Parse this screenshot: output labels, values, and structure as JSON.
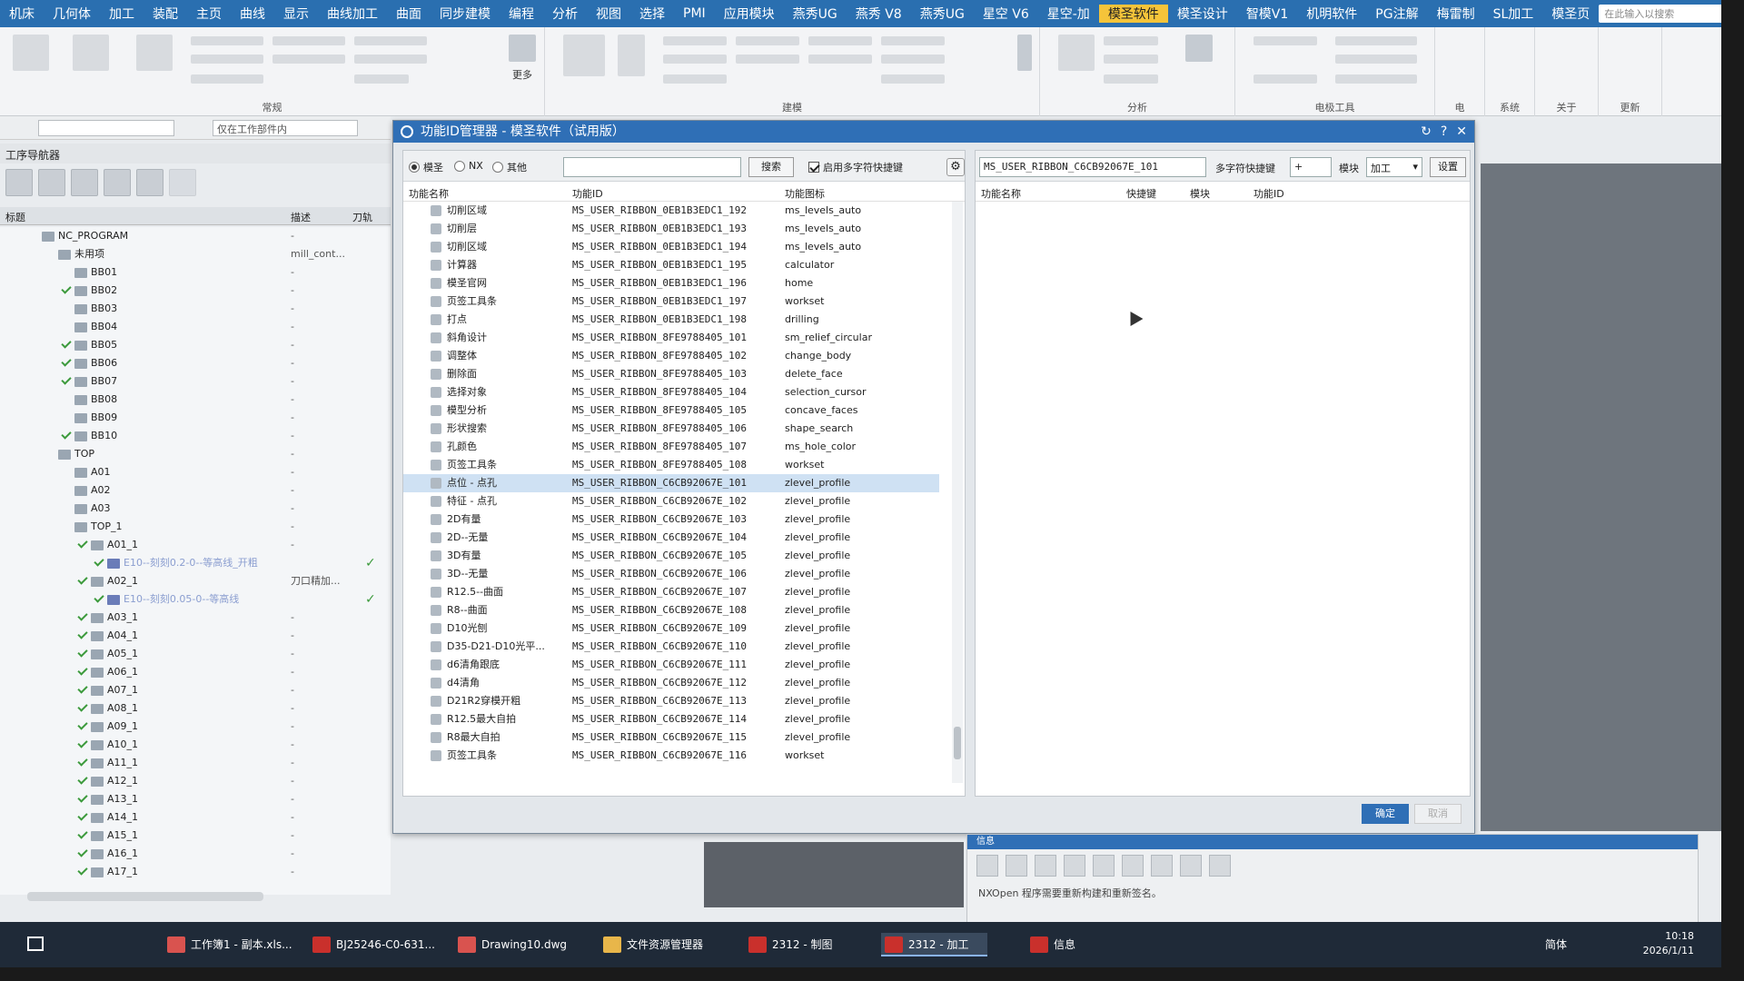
{
  "menubar": {
    "items": [
      "机床",
      "几何体",
      "加工",
      "装配",
      "主页",
      "曲线",
      "显示",
      "曲线加工",
      "曲面",
      "同步建模",
      "编程",
      "分析",
      "视图",
      "选择",
      "PMI",
      "应用模块",
      "燕秀UG",
      "燕秀 V8",
      "燕秀UG",
      "星空 V6",
      "星空-加",
      "模圣软件",
      "模圣设计",
      "智模V1",
      "机明软件",
      "PG注解",
      "梅雷制",
      "SL加工",
      "模圣页"
    ],
    "active_index": 21,
    "search_placeholder": "在此输入以搜索"
  },
  "ribbon": {
    "groups": [
      "常规",
      "建模",
      "分析",
      "电极工具",
      "电",
      "系统",
      "关于",
      "更新"
    ],
    "more_label": "更多"
  },
  "filter": {
    "combo2": "仅在工作部件内"
  },
  "navigator": {
    "title": "工序导航器",
    "col_name": "标题",
    "col_desc": "描述",
    "col_tool": "刀轨",
    "rows": [
      {
        "label": "NC_PROGRAM",
        "indent": 0,
        "check": false,
        "desc": "-"
      },
      {
        "label": "未用项",
        "indent": 1,
        "check": false,
        "desc": "mill_cont..."
      },
      {
        "label": "BB01",
        "indent": 2,
        "check": false,
        "desc": "-"
      },
      {
        "label": "BB02",
        "indent": 2,
        "check": true,
        "desc": "-"
      },
      {
        "label": "BB03",
        "indent": 2,
        "check": false,
        "desc": "-"
      },
      {
        "label": "BB04",
        "indent": 2,
        "check": false,
        "desc": "-"
      },
      {
        "label": "BB05",
        "indent": 2,
        "check": true,
        "desc": "-"
      },
      {
        "label": "BB06",
        "indent": 2,
        "check": true,
        "desc": "-"
      },
      {
        "label": "BB07",
        "indent": 2,
        "check": true,
        "desc": "-"
      },
      {
        "label": "BB08",
        "indent": 2,
        "check": false,
        "desc": "-"
      },
      {
        "label": "BB09",
        "indent": 2,
        "check": false,
        "desc": "-"
      },
      {
        "label": "BB10",
        "indent": 2,
        "check": true,
        "desc": "-"
      },
      {
        "label": "TOP",
        "indent": 1,
        "check": false,
        "desc": "-"
      },
      {
        "label": "A01",
        "indent": 2,
        "check": false,
        "desc": "-"
      },
      {
        "label": "A02",
        "indent": 2,
        "check": false,
        "desc": "-"
      },
      {
        "label": "A03",
        "indent": 2,
        "check": false,
        "desc": "-"
      },
      {
        "label": "TOP_1",
        "indent": 2,
        "check": false,
        "desc": "-"
      },
      {
        "label": "A01_1",
        "indent": 3,
        "check": true,
        "desc": "-"
      },
      {
        "label": "E10--刻刻0.2-0--等高线_开粗",
        "indent": 4,
        "check": true,
        "desc": "",
        "op": true,
        "done": true
      },
      {
        "label": "A02_1",
        "indent": 3,
        "check": true,
        "desc": "刀口精加..."
      },
      {
        "label": "E10--刻刻0.05-0--等高线",
        "indent": 4,
        "check": true,
        "desc": "",
        "op": true,
        "done": true
      },
      {
        "label": "A03_1",
        "indent": 3,
        "check": true,
        "desc": "-"
      },
      {
        "label": "A04_1",
        "indent": 3,
        "check": true,
        "desc": "-"
      },
      {
        "label": "A05_1",
        "indent": 3,
        "check": true,
        "desc": "-"
      },
      {
        "label": "A06_1",
        "indent": 3,
        "check": true,
        "desc": "-"
      },
      {
        "label": "A07_1",
        "indent": 3,
        "check": true,
        "desc": "-"
      },
      {
        "label": "A08_1",
        "indent": 3,
        "check": true,
        "desc": "-"
      },
      {
        "label": "A09_1",
        "indent": 3,
        "check": true,
        "desc": "-"
      },
      {
        "label": "A10_1",
        "indent": 3,
        "check": true,
        "desc": "-"
      },
      {
        "label": "A11_1",
        "indent": 3,
        "check": true,
        "desc": "-"
      },
      {
        "label": "A12_1",
        "indent": 3,
        "check": true,
        "desc": "-"
      },
      {
        "label": "A13_1",
        "indent": 3,
        "check": true,
        "desc": "-"
      },
      {
        "label": "A14_1",
        "indent": 3,
        "check": true,
        "desc": "-"
      },
      {
        "label": "A15_1",
        "indent": 3,
        "check": true,
        "desc": "-"
      },
      {
        "label": "A16_1",
        "indent": 3,
        "check": true,
        "desc": "-"
      },
      {
        "label": "A17_1",
        "indent": 3,
        "check": true,
        "desc": "-"
      }
    ]
  },
  "dialog": {
    "title": "功能ID管理器 - 模圣软件（试用版）",
    "radio_mosheng": "模圣",
    "radio_nx": "NX",
    "radio_other": "其他",
    "search_button": "搜索",
    "multi_char_check": "启用多字符快捷键",
    "col_name": "功能名称",
    "col_id": "功能ID",
    "col_icon": "功能图标",
    "rows": [
      {
        "name": "切削区域",
        "id": "MS_USER_RIBBON_0EB1B3EDC1_192",
        "icon": "ms_levels_auto"
      },
      {
        "name": "切削层",
        "id": "MS_USER_RIBBON_0EB1B3EDC1_193",
        "icon": "ms_levels_auto"
      },
      {
        "name": "切削区域",
        "id": "MS_USER_RIBBON_0EB1B3EDC1_194",
        "icon": "ms_levels_auto"
      },
      {
        "name": "计算器",
        "id": "MS_USER_RIBBON_0EB1B3EDC1_195",
        "icon": "calculator"
      },
      {
        "name": "模圣官网",
        "id": "MS_USER_RIBBON_0EB1B3EDC1_196",
        "icon": "home"
      },
      {
        "name": "页签工具条",
        "id": "MS_USER_RIBBON_0EB1B3EDC1_197",
        "icon": "workset"
      },
      {
        "name": "打点",
        "id": "MS_USER_RIBBON_0EB1B3EDC1_198",
        "icon": "drilling"
      },
      {
        "name": "斜角设计",
        "id": "MS_USER_RIBBON_8FE9788405_101",
        "icon": "sm_relief_circular"
      },
      {
        "name": "调整体",
        "id": "MS_USER_RIBBON_8FE9788405_102",
        "icon": "change_body"
      },
      {
        "name": "删除面",
        "id": "MS_USER_RIBBON_8FE9788405_103",
        "icon": "delete_face"
      },
      {
        "name": "选择对象",
        "id": "MS_USER_RIBBON_8FE9788405_104",
        "icon": "selection_cursor"
      },
      {
        "name": "模型分析",
        "id": "MS_USER_RIBBON_8FE9788405_105",
        "icon": "concave_faces"
      },
      {
        "name": "形状搜索",
        "id": "MS_USER_RIBBON_8FE9788405_106",
        "icon": "shape_search"
      },
      {
        "name": "孔颜色",
        "id": "MS_USER_RIBBON_8FE9788405_107",
        "icon": "ms_hole_color"
      },
      {
        "name": "页签工具条",
        "id": "MS_USER_RIBBON_8FE9788405_108",
        "icon": "workset"
      },
      {
        "name": "点位 - 点孔",
        "id": "MS_USER_RIBBON_C6CB92067E_101",
        "icon": "zlevel_profile",
        "selected": true
      },
      {
        "name": "特征 - 点孔",
        "id": "MS_USER_RIBBON_C6CB92067E_102",
        "icon": "zlevel_profile"
      },
      {
        "name": "2D有量",
        "id": "MS_USER_RIBBON_C6CB92067E_103",
        "icon": "zlevel_profile"
      },
      {
        "name": "2D--无量",
        "id": "MS_USER_RIBBON_C6CB92067E_104",
        "icon": "zlevel_profile"
      },
      {
        "name": "3D有量",
        "id": "MS_USER_RIBBON_C6CB92067E_105",
        "icon": "zlevel_profile"
      },
      {
        "name": "3D--无量",
        "id": "MS_USER_RIBBON_C6CB92067E_106",
        "icon": "zlevel_profile"
      },
      {
        "name": "R12.5--曲面",
        "id": "MS_USER_RIBBON_C6CB92067E_107",
        "icon": "zlevel_profile"
      },
      {
        "name": "R8--曲面",
        "id": "MS_USER_RIBBON_C6CB92067E_108",
        "icon": "zlevel_profile"
      },
      {
        "name": "D10光刨",
        "id": "MS_USER_RIBBON_C6CB92067E_109",
        "icon": "zlevel_profile"
      },
      {
        "name": "D35-D21-D10光平...",
        "id": "MS_USER_RIBBON_C6CB92067E_110",
        "icon": "zlevel_profile"
      },
      {
        "name": "d6清角跟底",
        "id": "MS_USER_RIBBON_C6CB92067E_111",
        "icon": "zlevel_profile"
      },
      {
        "name": "d4清角",
        "id": "MS_USER_RIBBON_C6CB92067E_112",
        "icon": "zlevel_profile"
      },
      {
        "name": "D21R2穿模开粗",
        "id": "MS_USER_RIBBON_C6CB92067E_113",
        "icon": "zlevel_profile"
      },
      {
        "name": "R12.5最大自拍",
        "id": "MS_USER_RIBBON_C6CB92067E_114",
        "icon": "zlevel_profile"
      },
      {
        "name": "R8最大自拍",
        "id": "MS_USER_RIBBON_C6CB92067E_115",
        "icon": "zlevel_profile"
      },
      {
        "name": "页签工具条",
        "id": "MS_USER_RIBBON_C6CB92067E_116",
        "icon": "workset"
      }
    ],
    "right": {
      "id_value": "MS_USER_RIBBON_C6CB92067E_101",
      "multi_label": "多字符快捷键",
      "multi_value": "+",
      "module_label": "模块",
      "module_value": "加工",
      "set_button": "设置",
      "col_name": "功能名称",
      "col_shortcut": "快捷键",
      "col_module": "模块",
      "col_id": "功能ID"
    },
    "ok": "确定",
    "cancel": "取消"
  },
  "info": {
    "title": "信息",
    "text": "NXOpen 程序需要重新构建和重新签名。"
  },
  "taskbar": {
    "tasks": [
      {
        "label": "工作簿1 - 副本.xls...",
        "color": "#d9534f"
      },
      {
        "label": "BJ25246-C0-631...",
        "color": "#c9302c"
      },
      {
        "label": "Drawing10.dwg",
        "color": "#d9534f"
      },
      {
        "label": "文件资源管理器",
        "color": "#e8b64a"
      },
      {
        "label": "2312 - 制图",
        "color": "#c9302c"
      },
      {
        "label": "2312 - 加工",
        "color": "#c9302c"
      },
      {
        "label": "信息",
        "color": "#c9302c"
      }
    ],
    "active_index": 5,
    "lang": "简体",
    "time": "10:18",
    "date": "2026/1/11"
  }
}
